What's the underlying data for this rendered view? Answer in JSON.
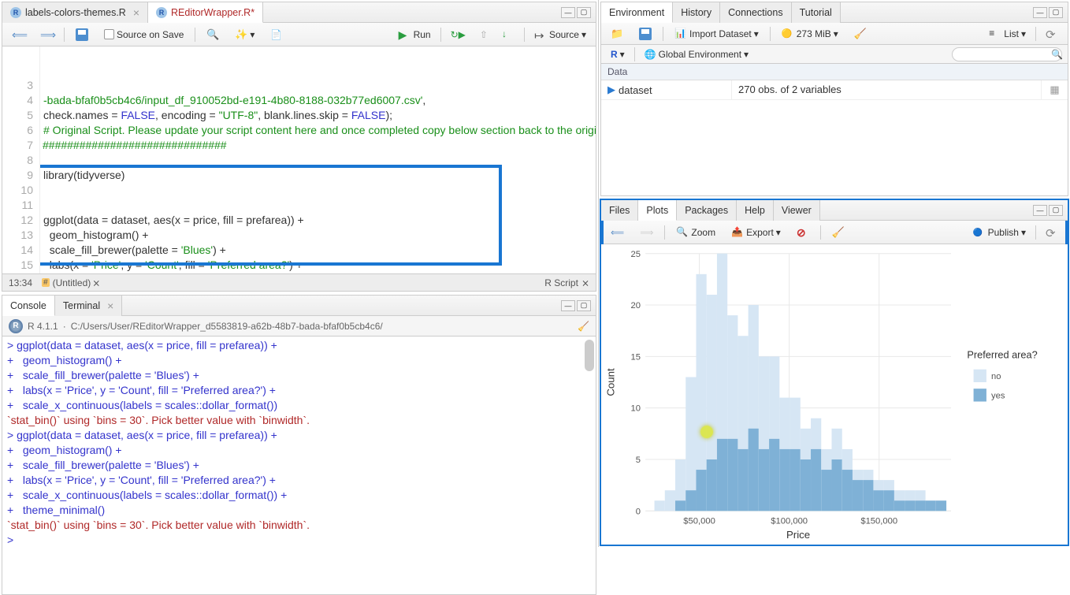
{
  "editor": {
    "tabs": [
      {
        "label": "labels-colors-themes.R",
        "active": false,
        "modified": false
      },
      {
        "label": "REditorWrapper.R*",
        "active": true,
        "modified": true
      }
    ],
    "sourceOnSave": "Source on Save",
    "run": "Run",
    "source": "Source",
    "gutter": [
      "",
      "",
      "3",
      "4",
      "5",
      "6",
      "7",
      "8",
      "9",
      "10",
      "11",
      "12",
      "13",
      "14",
      "15"
    ],
    "code_lines": [
      {
        "t": "str",
        "text": "-bada-bfaf0b5cb4c6/input_df_910052bd-e191-4b80-8188-032b77ed6007.csv'",
        "tail": ","
      },
      {
        "segments": [
          {
            "t": "",
            "text": "check.names = "
          },
          {
            "t": "cons",
            "text": "FALSE"
          },
          {
            "t": "",
            "text": ", encoding = "
          },
          {
            "t": "str",
            "text": "\"UTF-8\""
          },
          {
            "t": "",
            "text": ", blank.lines.skip = "
          },
          {
            "t": "cons",
            "text": "FALSE"
          },
          {
            "t": "",
            "text": ");"
          }
        ]
      },
      {
        "t": "com",
        "text": "# Original Script. Please update your script content here and once completed copy below section back to the original editing window #"
      },
      {
        "t": "com",
        "text": "##############################",
        "fold": true
      },
      {
        "t": "",
        "text": ""
      },
      {
        "segments": [
          {
            "t": "",
            "text": "library(tidyverse)"
          }
        ]
      },
      {
        "t": "",
        "text": ""
      },
      {
        "t": "",
        "text": ""
      },
      {
        "segments": [
          {
            "t": "",
            "text": "ggplot(data = dataset, aes(x = price, fill = prefarea)) +"
          }
        ]
      },
      {
        "segments": [
          {
            "t": "",
            "text": "  geom_histogram() +"
          }
        ]
      },
      {
        "segments": [
          {
            "t": "",
            "text": "  scale_fill_brewer(palette = "
          },
          {
            "t": "str",
            "text": "'Blues'"
          },
          {
            "t": "",
            "text": ") +"
          }
        ]
      },
      {
        "segments": [
          {
            "t": "",
            "text": "  labs(x = "
          },
          {
            "t": "str",
            "text": "'Price'"
          },
          {
            "t": "",
            "text": ", y = "
          },
          {
            "t": "str",
            "text": "'Count'"
          },
          {
            "t": "",
            "text": ", fill = "
          },
          {
            "t": "str",
            "text": "'Preferred area?'"
          },
          {
            "t": "",
            "text": ") +"
          }
        ]
      },
      {
        "segments": [
          {
            "t": "",
            "text": "  scale_x_continuous(labels = scales::dollar_format()) +"
          }
        ]
      },
      {
        "segments": [
          {
            "t": "",
            "text": "  theme_minimal()"
          }
        ]
      },
      {
        "t": "",
        "text": ""
      }
    ],
    "status_pos": "13:34",
    "status_name": "(Untitled)",
    "status_type": "R Script"
  },
  "console": {
    "tabs": [
      "Console",
      "Terminal"
    ],
    "version": "R 4.1.1",
    "path": "C:/Users/User/REditorWrapper_d5583819-a62b-48b7-bada-bfaf0b5cb4c6/",
    "lines": [
      {
        "p": ">",
        "t": "prompt",
        "text": "ggplot(data = dataset, aes(x = price, fill = prefarea)) +"
      },
      {
        "p": "+",
        "t": "cont",
        "text": "  geom_histogram() +"
      },
      {
        "p": "+",
        "t": "cont",
        "text": "  scale_fill_brewer(palette = 'Blues') +"
      },
      {
        "p": "+",
        "t": "cont",
        "text": "  labs(x = 'Price', y = 'Count', fill = 'Preferred area?') +"
      },
      {
        "p": "+",
        "t": "cont",
        "text": "  scale_x_continuous(labels = scales::dollar_format())"
      },
      {
        "p": "",
        "t": "msg",
        "text": "`stat_bin()` using `bins = 30`. Pick better value with `binwidth`."
      },
      {
        "p": ">",
        "t": "prompt",
        "text": "ggplot(data = dataset, aes(x = price, fill = prefarea)) +"
      },
      {
        "p": "+",
        "t": "cont",
        "text": "  geom_histogram() +"
      },
      {
        "p": "+",
        "t": "cont",
        "text": "  scale_fill_brewer(palette = 'Blues') +"
      },
      {
        "p": "+",
        "t": "cont",
        "text": "  labs(x = 'Price', y = 'Count', fill = 'Preferred area?') +"
      },
      {
        "p": "+",
        "t": "cont",
        "text": "  scale_x_continuous(labels = scales::dollar_format()) +"
      },
      {
        "p": "+",
        "t": "cont",
        "text": "  theme_minimal()"
      },
      {
        "p": "",
        "t": "msg",
        "text": "`stat_bin()` using `bins = 30`. Pick better value with `binwidth`."
      },
      {
        "p": ">",
        "t": "prompt",
        "text": ""
      }
    ]
  },
  "env": {
    "tabs": [
      "Environment",
      "History",
      "Connections",
      "Tutorial"
    ],
    "import": "Import Dataset",
    "mem": "273 MiB",
    "viewmode": "List",
    "scope_r": "R",
    "scope_env": "Global Environment",
    "search_ph": "",
    "header": "Data",
    "row": {
      "name": "dataset",
      "desc": "270 obs. of 2 variables"
    }
  },
  "plots": {
    "tabs": [
      "Files",
      "Plots",
      "Packages",
      "Help",
      "Viewer"
    ],
    "zoom": "Zoom",
    "export": "Export",
    "publish": "Publish"
  },
  "chart_data": {
    "type": "bar",
    "stacked": true,
    "title": "",
    "xlabel": "Price",
    "ylabel": "Count",
    "legend_title": "Preferred area?",
    "xlim": [
      20000,
      190000
    ],
    "ylim": [
      0,
      25
    ],
    "x_ticks": [
      50000,
      100000,
      150000
    ],
    "x_tick_labels": [
      "$50,000",
      "$100,000",
      "$150,000"
    ],
    "y_ticks": [
      0,
      5,
      10,
      15,
      20,
      25
    ],
    "bin_width": 5800,
    "bin_starts": [
      25000,
      30800,
      36600,
      42400,
      48200,
      54000,
      59800,
      65600,
      71400,
      77200,
      83000,
      88800,
      94600,
      100400,
      106200,
      112000,
      117800,
      123600,
      129400,
      135200,
      141000,
      146800,
      152600,
      158400,
      164200,
      170000,
      175800,
      181600
    ],
    "series": [
      {
        "name": "no",
        "color": "#d6e6f4",
        "values": [
          1,
          2,
          5,
          13,
          23,
          21,
          25,
          19,
          17,
          20,
          15,
          15,
          11,
          11,
          8,
          9,
          6,
          8,
          6,
          4,
          4,
          3,
          3,
          2,
          2,
          2,
          1,
          1
        ]
      },
      {
        "name": "yes",
        "color": "#7fb1d6",
        "values": [
          0,
          0,
          1,
          2,
          4,
          5,
          7,
          7,
          6,
          8,
          6,
          7,
          6,
          6,
          5,
          6,
          4,
          5,
          4,
          3,
          3,
          2,
          2,
          1,
          1,
          1,
          1,
          1
        ]
      }
    ]
  }
}
